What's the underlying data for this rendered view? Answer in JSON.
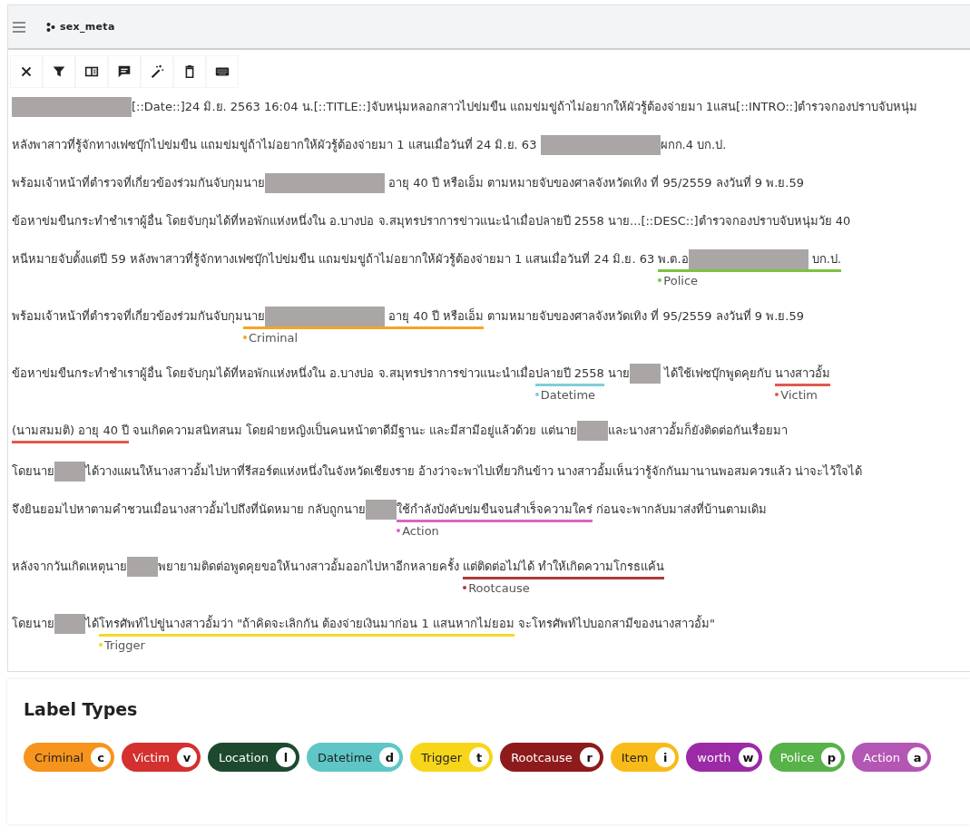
{
  "project": {
    "name": "sex_meta"
  },
  "toolbar": [
    {
      "kind": "close"
    },
    {
      "kind": "filter"
    },
    {
      "kind": "split"
    },
    {
      "kind": "comment"
    },
    {
      "kind": "wand"
    },
    {
      "kind": "delete"
    },
    {
      "kind": "keyboard"
    }
  ],
  "document": {
    "lines": [
      [
        {
          "kind": "redacted_long"
        },
        {
          "kind": "text",
          "text": "[::Date::]24 มิ.ย. 2563 16:04 น.[::TITLE::]จับหนุ่มหลอกสาวไปข่มขืน แถมข่มขู่ถ้าไม่อยากให้ผัวรู้ต้องจ่ายมา 1แสน[::INTRO::]ตำรวจกองปราบจับหนุ่ม"
        }
      ],
      [
        {
          "kind": "text",
          "text": "หลังพาสาวที่รู้จักทางเฟซบุ๊กไปข่มขืน แถมข่มขู่ถ้าไม่อยากให้ผัวรู้ต้องจ่ายมา 1 แสนเมื่อวันที่ 24 มิ.ย. 63 "
        },
        {
          "kind": "redacted_long"
        },
        {
          "kind": "text",
          "text": "ผกก.4 บก.ป."
        }
      ],
      [
        {
          "kind": "text",
          "text": "พร้อมเจ้าหน้าที่ตำรวจที่เกี่ยวข้องร่วมกันจับกุมนาย"
        },
        {
          "kind": "redacted_long"
        },
        {
          "kind": "text",
          "text": " อายุ 40 ปี หรือเอ็ม ตามหมายจับของศาลจังหวัดเทิง ที่ 95/2559 ลงวันที่ 9 พ.ย.59"
        }
      ],
      [
        {
          "kind": "text",
          "text": "ข้อหาข่มขืนกระทำชำเราผู้อื่น โดยจับกุมได้ที่หอพักแห่งหนึ่งใน อ.บางบ่อ จ.สมุทรปราการข่าวแนะนำเมื่อปลายปี 2558 นาย...[::DESC::]ตำรวจกองปราบจับหนุ่มวัย 40"
        }
      ],
      [
        {
          "kind": "text",
          "text": "หนีหมายจับตั้งแต่ปี 59 หลังพาสาวที่รู้จักทางเฟซบุ๊กไปข่มขืน แถมข่มขู่ถ้าไม่อยากให้ผัวรู้ต้องจ่ายมา 1 แสนเมื่อวันที่ 24 มิ.ย. 63 "
        },
        {
          "kind": "span",
          "label": "Police",
          "color": "#7dc242",
          "parts": [
            {
              "kind": "text",
              "text": "พ.ต.อ"
            },
            {
              "kind": "redacted_long"
            },
            {
              "kind": "text",
              "text": " บก.ป."
            }
          ]
        }
      ],
      [
        {
          "kind": "text",
          "text": "พร้อมเจ้าหน้าที่ตำรวจที่เกี่ยวข้องร่วมกันจับกุม"
        },
        {
          "kind": "span",
          "label": "Criminal",
          "color": "#f5a623",
          "parts": [
            {
              "kind": "text",
              "text": "นาย"
            },
            {
              "kind": "redacted_long"
            },
            {
              "kind": "text",
              "text": " อายุ 40 ปี หรือเอ็ม"
            }
          ]
        },
        {
          "kind": "text",
          "text": " ตามหมายจับของศาลจังหวัดเทิง ที่ 95/2559 ลงวันที่ 9 พ.ย.59"
        }
      ],
      [
        {
          "kind": "text",
          "text": "ข้อหาข่มขืนกระทำชำเราผู้อื่น โดยจับกุมได้ที่หอพักแห่งหนึ่งใน อ.บางบ่อ จ.สมุทรปราการข่าวแนะนำเมื่อ"
        },
        {
          "kind": "span",
          "label": "Datetime",
          "color": "#7ecfd6",
          "parts": [
            {
              "kind": "text",
              "text": "ปลายปี 2558"
            }
          ]
        },
        {
          "kind": "text",
          "text": " นาย"
        },
        {
          "kind": "redacted_short"
        },
        {
          "kind": "text",
          "text": " ได้ใช้เฟซบุ๊กพูดคุยกับ "
        },
        {
          "kind": "span",
          "label": "Victim",
          "color": "#e05a4e",
          "parts": [
            {
              "kind": "text",
              "text": "นางสาวอั้ม"
            }
          ]
        }
      ],
      [
        {
          "kind": "span",
          "color": "#e05a4e",
          "parts": [
            {
              "kind": "text",
              "text": "(นามสมมติ) อายุ 40 ปี"
            }
          ]
        },
        {
          "kind": "text",
          "text": " จนเกิดความสนิทสนม โดยฝ่ายหญิงเป็นคนหน้าตาดีมีฐานะ และมีสามีอยู่แล้วด้วย แต่นาย"
        },
        {
          "kind": "redacted_short"
        },
        {
          "kind": "text",
          "text": "และนางสาวอั้มก็ยังติดต่อกันเรื่อยมา"
        }
      ],
      [
        {
          "kind": "text",
          "text": "โดยนาย"
        },
        {
          "kind": "redacted_short"
        },
        {
          "kind": "text",
          "text": "ได้วางแผนให้นางสาวอั้มไปหาที่รีสอร์ตแห่งหนึ่งในจังหวัดเชียงราย อ้างว่าจะพาไปเที่ยวกินข้าว นางสาวอั้มเห็นว่ารู้จักกันมานานพอสมควรแล้ว น่าจะไว้ใจได้"
        }
      ],
      [
        {
          "kind": "text",
          "text": "จึงยินยอมไปหาตามคำชวนเมื่อนางสาวอั้มไปถึงที่นัดหมาย กลับถูกนาย"
        },
        {
          "kind": "redacted_short"
        },
        {
          "kind": "span",
          "label": "Action",
          "color": "#d667c2",
          "parts": [
            {
              "kind": "text",
              "text": "ใช้กำลังบังคับข่มขืนจนสำเร็จความใคร่"
            }
          ]
        },
        {
          "kind": "text",
          "text": " ก่อนจะพากลับมาส่งที่บ้านตามเดิม"
        }
      ],
      [
        {
          "kind": "text",
          "text": "หลังจากวันเกิดเหตุนาย"
        },
        {
          "kind": "redacted_short"
        },
        {
          "kind": "text",
          "text": "พยายามติดต่อพูดคุยขอให้นางสาวอั้มออกไปหาอีกหลายครั้ง "
        },
        {
          "kind": "span",
          "label": "Rootcause",
          "color": "#b03a3a",
          "parts": [
            {
              "kind": "text",
              "text": "แต่ติดต่อไม่ได้ ทำให้เกิดความโกรธแค้น"
            }
          ]
        }
      ],
      [
        {
          "kind": "text",
          "text": "โดยนาย"
        },
        {
          "kind": "redacted_short"
        },
        {
          "kind": "text",
          "text": "ได้"
        },
        {
          "kind": "span",
          "label": "Trigger",
          "color": "#f5d82a",
          "parts": [
            {
              "kind": "text",
              "text": "โทรศัพท์ไปขู่นางสาวอั้มว่า \"ถ้าคิดจะเลิกกัน ต้องจ่ายเงินมาก่อน 1 แสนหากไม่ยอม"
            }
          ]
        },
        {
          "kind": "text",
          "text": " จะโทรศัพท์ไปบอกสามีของนางสาวอั้ม\""
        }
      ]
    ]
  },
  "label_types": {
    "title": "Label Types",
    "items": [
      {
        "name": "Criminal",
        "key": "c",
        "color": "#f7941d"
      },
      {
        "name": "Victim",
        "key": "v",
        "color": "#d3302f"
      },
      {
        "name": "Location",
        "key": "l",
        "color": "#1d4a2f"
      },
      {
        "name": "Datetime",
        "key": "d",
        "color": "#5ec6c6"
      },
      {
        "name": "Trigger",
        "key": "t",
        "color": "#f7d61a"
      },
      {
        "name": "Rootcause",
        "key": "r",
        "color": "#8e1b1b"
      },
      {
        "name": "Item",
        "key": "i",
        "color": "#f9bb1a"
      },
      {
        "name": "worth",
        "key": "w",
        "color": "#9b2aa6"
      },
      {
        "name": "Police",
        "key": "p",
        "color": "#57b249"
      },
      {
        "name": "Action",
        "key": "a",
        "color": "#b456b4"
      }
    ]
  }
}
